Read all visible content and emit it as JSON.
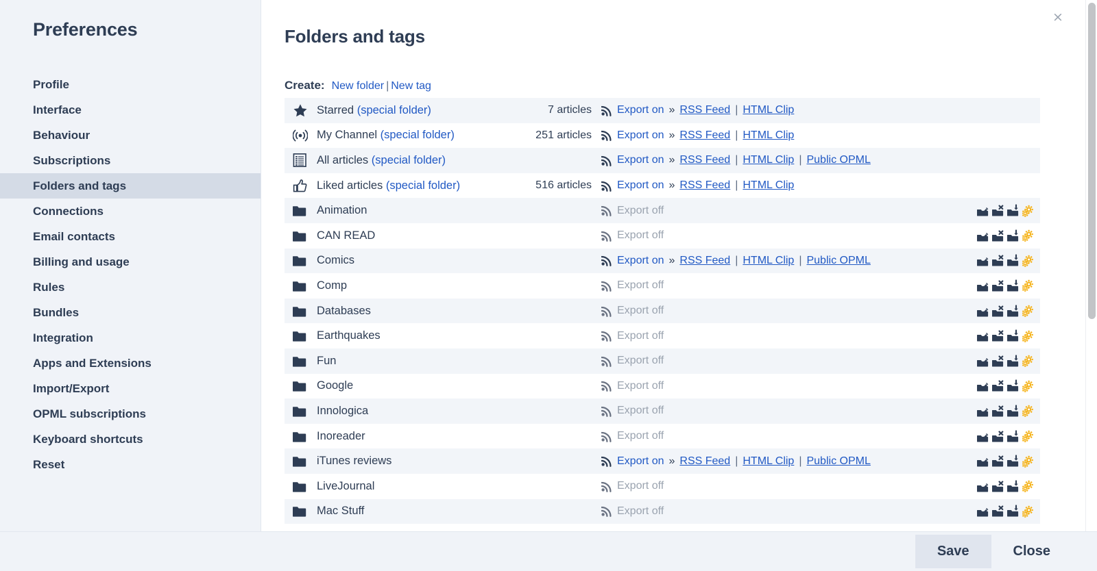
{
  "sidebar": {
    "title": "Preferences",
    "items": [
      {
        "label": "Profile",
        "active": false
      },
      {
        "label": "Interface",
        "active": false
      },
      {
        "label": "Behaviour",
        "active": false
      },
      {
        "label": "Subscriptions",
        "active": false
      },
      {
        "label": "Folders and tags",
        "active": true
      },
      {
        "label": "Connections",
        "active": false
      },
      {
        "label": "Email contacts",
        "active": false
      },
      {
        "label": "Billing and usage",
        "active": false
      },
      {
        "label": "Rules",
        "active": false
      },
      {
        "label": "Bundles",
        "active": false
      },
      {
        "label": "Integration",
        "active": false
      },
      {
        "label": "Apps and Extensions",
        "active": false
      },
      {
        "label": "Import/Export",
        "active": false
      },
      {
        "label": "OPML subscriptions",
        "active": false
      },
      {
        "label": "Keyboard shortcuts",
        "active": false
      },
      {
        "label": "Reset",
        "active": false
      }
    ]
  },
  "main": {
    "page_title": "Folders and tags",
    "close_icon": "×",
    "create": {
      "label": "Create:",
      "new_folder": "New folder",
      "separator": "|",
      "new_tag": "New tag"
    },
    "export_labels": {
      "on": "Export on",
      "off": "Export off",
      "chevron": "»",
      "rss_feed": "RSS Feed",
      "html_clip": "HTML Clip",
      "public_opml": "Public OPML",
      "pipe": "|"
    },
    "special_suffix": "(special folder)",
    "rows": [
      {
        "icon": "star-icon",
        "name": "Starred",
        "special": true,
        "count": "7 articles",
        "export": "on",
        "links": [
          "RSS Feed",
          "HTML Clip"
        ],
        "actions": false
      },
      {
        "icon": "broadcast-icon",
        "name": "My Channel",
        "special": true,
        "count": "251 articles",
        "export": "on",
        "links": [
          "RSS Feed",
          "HTML Clip"
        ],
        "actions": false
      },
      {
        "icon": "articles-icon",
        "name": "All articles",
        "special": true,
        "count": "",
        "export": "on",
        "links": [
          "RSS Feed",
          "HTML Clip",
          "Public OPML"
        ],
        "actions": false
      },
      {
        "icon": "thumbs-up-icon",
        "name": "Liked articles",
        "special": true,
        "count": "516 articles",
        "export": "on",
        "links": [
          "RSS Feed",
          "HTML Clip"
        ],
        "actions": false
      },
      {
        "icon": "folder-icon",
        "name": "Animation",
        "special": false,
        "count": "",
        "export": "off",
        "links": [],
        "actions": true
      },
      {
        "icon": "folder-icon",
        "name": "CAN READ",
        "special": false,
        "count": "",
        "export": "off",
        "links": [],
        "actions": true
      },
      {
        "icon": "folder-icon",
        "name": "Comics",
        "special": false,
        "count": "",
        "export": "on",
        "links": [
          "RSS Feed",
          "HTML Clip",
          "Public OPML"
        ],
        "actions": true
      },
      {
        "icon": "folder-icon",
        "name": "Comp",
        "special": false,
        "count": "",
        "export": "off",
        "links": [],
        "actions": true
      },
      {
        "icon": "folder-icon",
        "name": "Databases",
        "special": false,
        "count": "",
        "export": "off",
        "links": [],
        "actions": true
      },
      {
        "icon": "folder-icon",
        "name": "Earthquakes",
        "special": false,
        "count": "",
        "export": "off",
        "links": [],
        "actions": true
      },
      {
        "icon": "folder-icon",
        "name": "Fun",
        "special": false,
        "count": "",
        "export": "off",
        "links": [],
        "actions": true
      },
      {
        "icon": "folder-icon",
        "name": "Google",
        "special": false,
        "count": "",
        "export": "off",
        "links": [],
        "actions": true
      },
      {
        "icon": "folder-icon",
        "name": "Innologica",
        "special": false,
        "count": "",
        "export": "off",
        "links": [],
        "actions": true
      },
      {
        "icon": "folder-icon",
        "name": "Inoreader",
        "special": false,
        "count": "",
        "export": "off",
        "links": [],
        "actions": true
      },
      {
        "icon": "folder-icon",
        "name": "iTunes reviews",
        "special": false,
        "count": "",
        "export": "on",
        "links": [
          "RSS Feed",
          "HTML Clip",
          "Public OPML"
        ],
        "actions": true
      },
      {
        "icon": "folder-icon",
        "name": "LiveJournal",
        "special": false,
        "count": "",
        "export": "off",
        "links": [],
        "actions": true
      },
      {
        "icon": "folder-icon",
        "name": "Mac Stuff",
        "special": false,
        "count": "",
        "export": "off",
        "links": [],
        "actions": true
      }
    ],
    "row_action_icons": [
      "folder-edit-icon",
      "folder-delete-icon",
      "folder-download-icon",
      "folder-settings-gear-icon"
    ]
  },
  "footer": {
    "save_label": "Save",
    "close_label": "Close"
  },
  "colors": {
    "link": "#2159c4",
    "text": "#2e3d54",
    "sidebar_bg": "#f0f3f8",
    "active_nav_bg": "#d4dbe6",
    "row_alt_bg": "#f2f5f9",
    "muted": "#9aa3af",
    "gear": "#f5b217"
  }
}
